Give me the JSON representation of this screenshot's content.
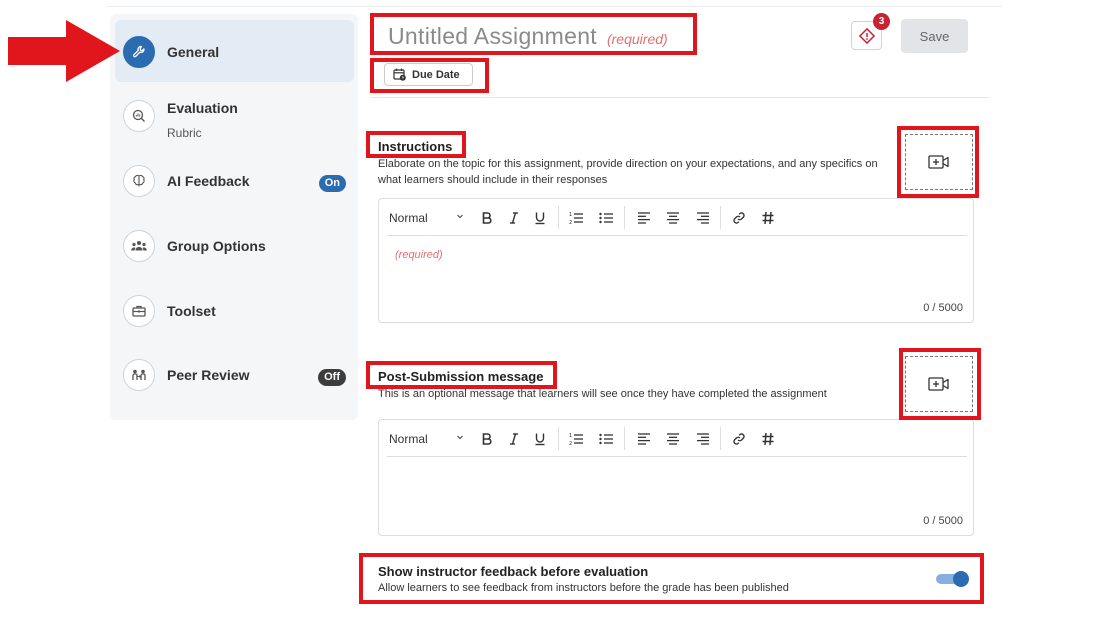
{
  "sidebar": {
    "items": [
      {
        "label": "General",
        "icon": "wrench-icon"
      },
      {
        "label": "Evaluation",
        "sub": "Rubric",
        "icon": "chart-magnifier-icon"
      },
      {
        "label": "AI Feedback",
        "icon": "brain-icon",
        "badge": "On"
      },
      {
        "label": "Group Options",
        "icon": "group-icon"
      },
      {
        "label": "Toolset",
        "icon": "toolbox-icon"
      },
      {
        "label": "Peer Review",
        "icon": "peer-review-icon",
        "badge": "Off"
      }
    ]
  },
  "header": {
    "title": "Untitled Assignment",
    "required": "(required)",
    "due_date_label": "Due Date",
    "alert_count": "3",
    "save_label": "Save"
  },
  "instructions": {
    "title": "Instructions",
    "description": "Elaborate on the topic for this assignment, provide direction on your expectations, and any specifics on what learners should include in their responses",
    "placeholder": "(required)",
    "counter": "0 / 5000"
  },
  "post_submission": {
    "title": "Post-Submission message",
    "description": "This is an optional message that learners will see once they have completed the assignment",
    "counter": "0 / 5000"
  },
  "toolbar": {
    "format": "Normal"
  },
  "show_feedback": {
    "title": "Show instructor feedback before evaluation",
    "description": "Allow learners to see feedback from instructors before the grade has been published",
    "enabled": true
  },
  "colors": {
    "accent": "#2b6cb0",
    "highlight": "#e0161c",
    "required": "#e0706f",
    "badge_off": "#3d3d3d"
  }
}
